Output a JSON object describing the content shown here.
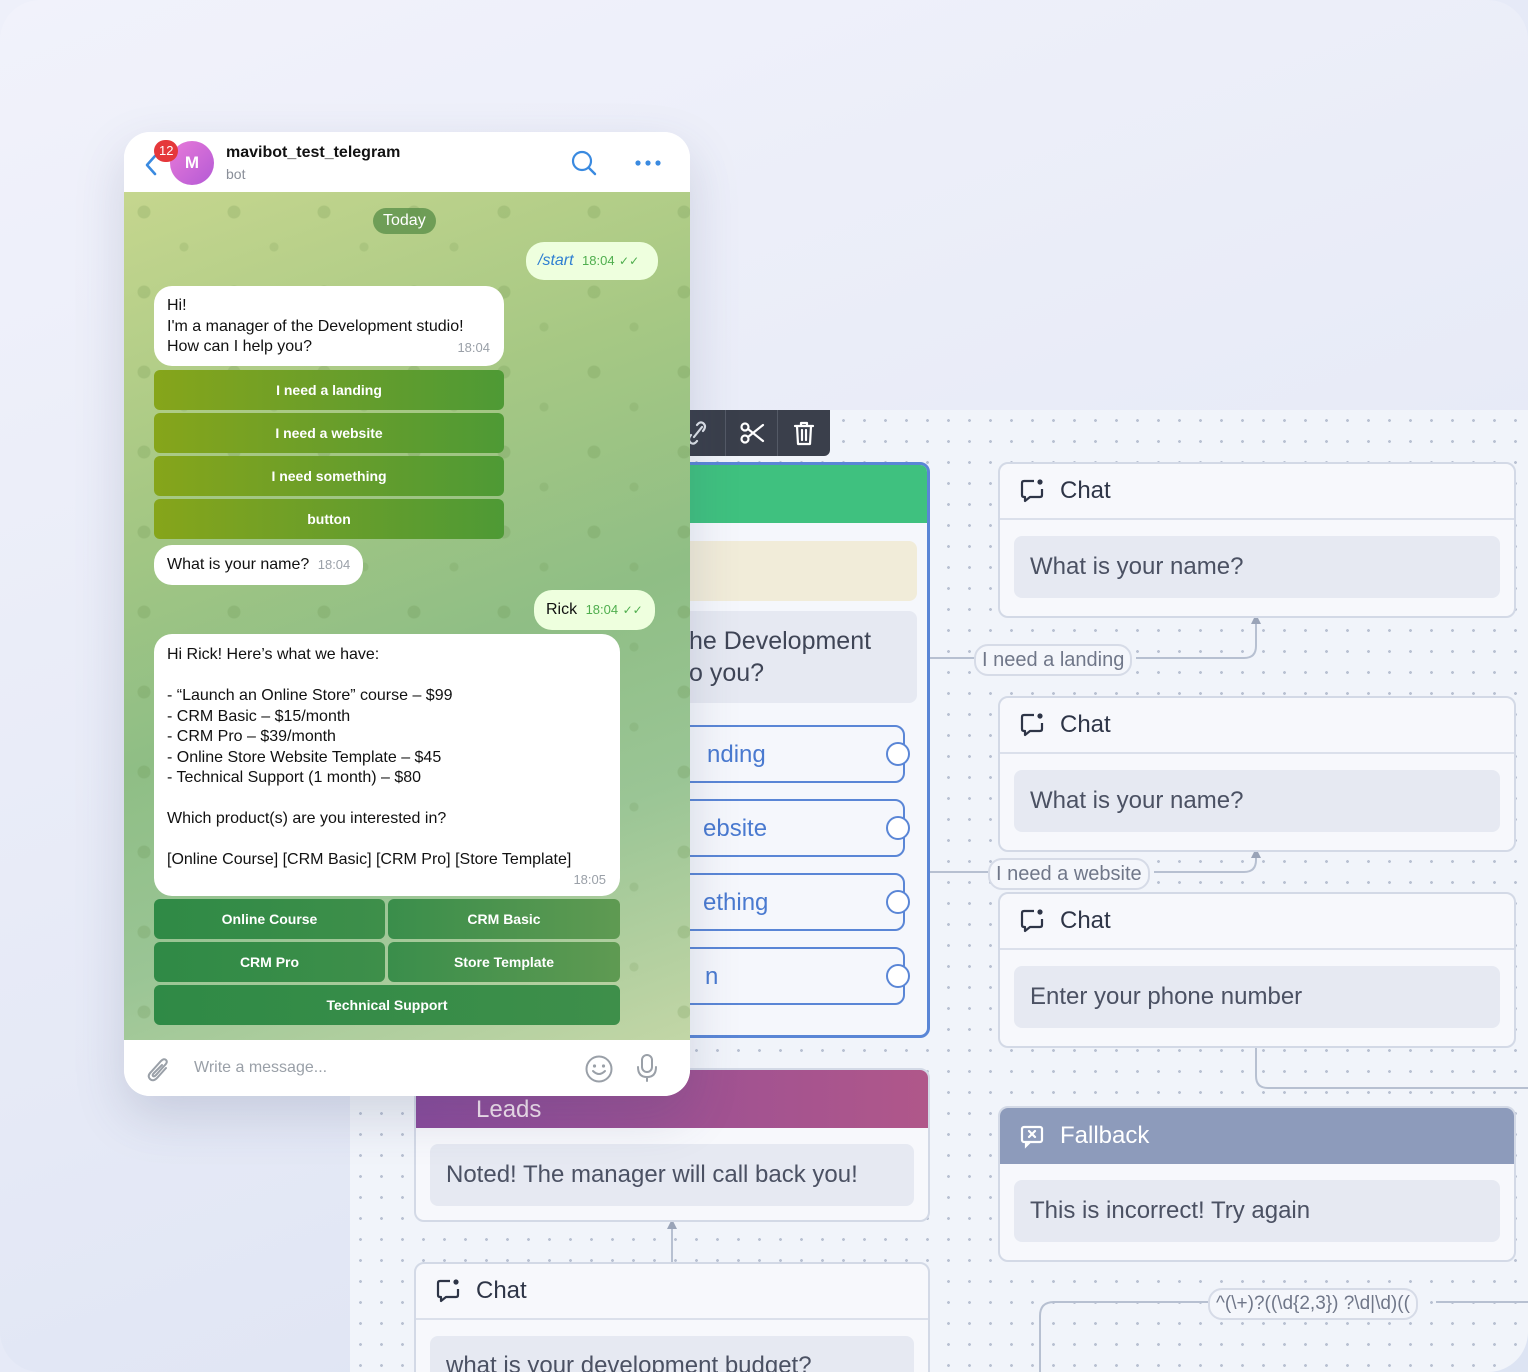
{
  "telegram": {
    "unread_badge": "12",
    "avatar_letter": "M",
    "chat_title": "mavibot_test_telegram",
    "chat_subtitle": "bot",
    "date_separator": "Today",
    "messages": [
      {
        "text": "/start",
        "time": "18:04",
        "direction": "out"
      },
      {
        "lines": [
          "Hi!",
          "I'm a manager of the Development studio!",
          "How can I help you?"
        ],
        "time": "18:04",
        "direction": "in"
      },
      {
        "text": "What is your name?",
        "time": "18:04",
        "direction": "in"
      },
      {
        "text": "Rick",
        "time": "18:04",
        "direction": "out"
      },
      {
        "lines": [
          "Hi Rick! Here’s what we have:",
          "",
          "- “Launch an Online Store” course – $99",
          "- CRM Basic – $15/month",
          "- CRM Pro – $39/month",
          "- Online Store Website Template – $45",
          "- Technical Support (1 month) – $80",
          "",
          "Which product(s) are you interested in?",
          "",
          "[Online Course] [CRM Basic] [CRM Pro] [Store Template]"
        ],
        "time": "18:05",
        "direction": "in"
      }
    ],
    "keyboard_1": [
      "I need a landing",
      "I need a website",
      "I need something",
      "button"
    ],
    "keyboard_2": [
      "Online Course",
      "CRM Basic",
      "CRM Pro",
      "Store Template",
      "Technical Support"
    ],
    "input_placeholder": "Write a message..."
  },
  "flow": {
    "start_node": {
      "text_lines": [
        "he Development",
        "o you?"
      ],
      "buttons": [
        "nding",
        "ebsite",
        "ething",
        "n"
      ]
    },
    "chat_nodes": [
      {
        "title": "Chat",
        "text": "What is your name?"
      },
      {
        "title": "Chat",
        "text": "What is your name?"
      },
      {
        "title": "Chat",
        "text": "Enter your phone number"
      },
      {
        "title": "Chat",
        "text": "what is your development budget?"
      }
    ],
    "fallback_node": {
      "title": "Fallback",
      "text": "This is incorrect! Try again"
    },
    "leads_node": {
      "title": "Leads",
      "text": "Noted! The manager will call back you!"
    },
    "connection_labels": [
      "I need a landing",
      "I need a website",
      "^(\\+)?((\\d{2,3}) ?\\d|\\d)(("
    ]
  },
  "colors": {
    "start_header": "#3fc17f",
    "start_border": "#5a86d6",
    "fallback_header": "#8d9bbb",
    "leads_header": "#a0528f",
    "telegram_badge": "#e5383b"
  }
}
